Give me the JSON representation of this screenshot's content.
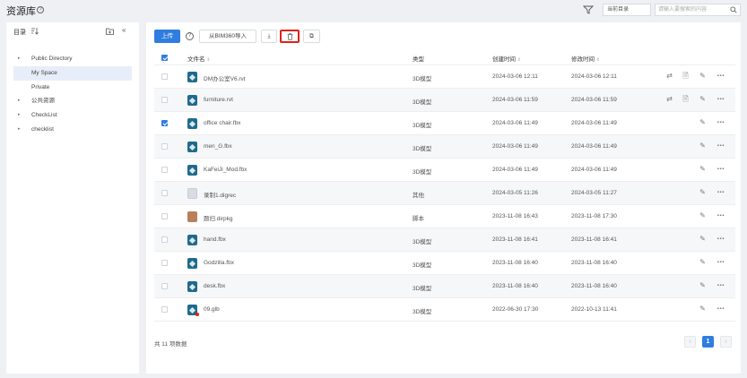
{
  "header": {
    "title": "资源库",
    "help": "?",
    "scope_select": "当前目录",
    "search_placeholder": "请输入要搜索的内容"
  },
  "sidebar": {
    "title": "目录",
    "collapse": "«",
    "items": [
      {
        "label": "Public Directory",
        "expandable": true,
        "active": false
      },
      {
        "label": "My Space",
        "expandable": false,
        "active": true
      },
      {
        "label": "Private",
        "expandable": false,
        "active": false
      },
      {
        "label": "公共资源",
        "expandable": true,
        "active": false
      },
      {
        "label": "CheckList",
        "expandable": true,
        "active": false
      },
      {
        "label": "checklist",
        "expandable": true,
        "active": false
      }
    ]
  },
  "toolbar": {
    "upload_label": "上传",
    "help": "?",
    "import_label": "从BIM360导入",
    "download_glyph": "⤓",
    "delete_glyph": "🗑",
    "copy_glyph": "⧉"
  },
  "table": {
    "headers": {
      "name": "文件名",
      "type": "类型",
      "created": "创建时间",
      "modified": "修改时间"
    },
    "sort_glyph": "⇕",
    "rows": [
      {
        "name": "DM办公室V6.rvt",
        "type": "3D模型",
        "created": "2024-03-06 12:11",
        "modified": "2024-03-06 12:11",
        "checked": false,
        "icon": "model-icon",
        "sync": true
      },
      {
        "name": "furniture.rvt",
        "type": "3D模型",
        "created": "2024-03-06 11:59",
        "modified": "2024-03-06 11:59",
        "checked": false,
        "icon": "model-icon",
        "sync": true
      },
      {
        "name": "office chair.fbx",
        "type": "3D模型",
        "created": "2024-03-06 11:49",
        "modified": "2024-03-06 11:49",
        "checked": true,
        "icon": "model-icon",
        "sync": false
      },
      {
        "name": "men_G.fbx",
        "type": "3D模型",
        "created": "2024-03-06 11:49",
        "modified": "2024-03-06 11:49",
        "checked": false,
        "icon": "model-icon",
        "sync": false
      },
      {
        "name": "KaFeiJi_Mod.fbx",
        "type": "3D模型",
        "created": "2024-03-06 11:49",
        "modified": "2024-03-06 11:49",
        "checked": false,
        "icon": "model-icon",
        "sync": false
      },
      {
        "name": "录制1.digrec",
        "type": "其他",
        "created": "2024-03-05 11:26",
        "modified": "2024-03-05 11:27",
        "checked": false,
        "icon": "document-icon",
        "sync": false
      },
      {
        "name": "题扫.dirpkg",
        "type": "脚本",
        "created": "2023-11-08 16:43",
        "modified": "2023-11-08 17:30",
        "checked": false,
        "icon": "image-icon",
        "sync": false
      },
      {
        "name": "hand.fbx",
        "type": "3D模型",
        "created": "2023-11-08 16:41",
        "modified": "2023-11-08 16:41",
        "checked": false,
        "icon": "model-icon",
        "sync": false
      },
      {
        "name": "Godzilla.fbx",
        "type": "3D模型",
        "created": "2023-11-08 16:40",
        "modified": "2023-11-08 16:40",
        "checked": false,
        "icon": "model-icon",
        "sync": false
      },
      {
        "name": "desk.fbx",
        "type": "3D模型",
        "created": "2023-11-08 16:40",
        "modified": "2023-11-08 16:40",
        "checked": false,
        "icon": "model-icon",
        "sync": false
      },
      {
        "name": "09.glb",
        "type": "3D模型",
        "created": "2022-06-30 17:30",
        "modified": "2022-10-13 11:41",
        "checked": false,
        "icon": "model-icon",
        "sync": false,
        "badge": true
      }
    ]
  },
  "footer": {
    "count_text": "共 11 项数据",
    "prev": "‹",
    "current_page": "1",
    "next": "›"
  },
  "colors": {
    "accent": "#2f7de1",
    "highlight_border": "#e0201b",
    "model_icon": "#1f6b8f"
  }
}
